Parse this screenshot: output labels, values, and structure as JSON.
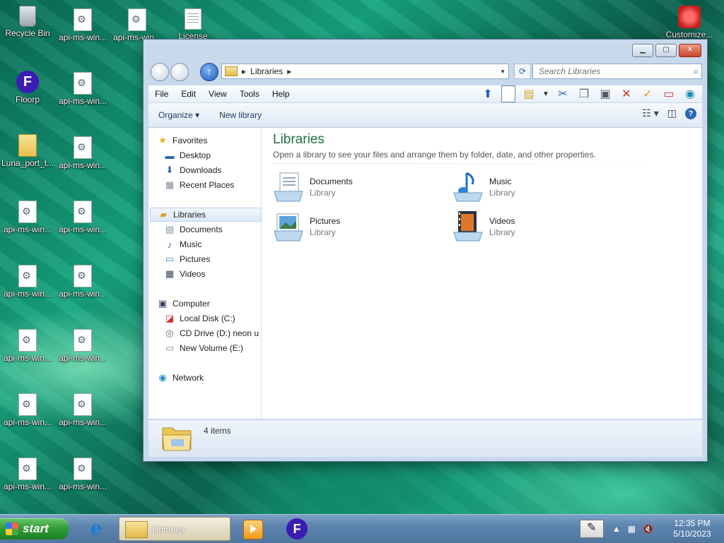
{
  "desktop": {
    "icons": [
      {
        "label": "Recycle Bin"
      },
      {
        "label": "api-ms-win..."
      },
      {
        "label": "api-ms-win..."
      },
      {
        "label": "License"
      },
      {
        "label": "Customize..."
      },
      {
        "label": "Floorp"
      },
      {
        "label": "api-ms-win..."
      },
      {
        "label": "Luna_port_t..."
      },
      {
        "label": "api-ms-win..."
      },
      {
        "label": "api-ms-win..."
      },
      {
        "label": "api-ms-win..."
      },
      {
        "label": "api-ms-win..."
      },
      {
        "label": "api-ms-win..."
      },
      {
        "label": "api-ms-win..."
      },
      {
        "label": "api-ms-win..."
      },
      {
        "label": "api-ms-win..."
      },
      {
        "label": "api-ms-win..."
      },
      {
        "label": "api-ms-win..."
      },
      {
        "label": "api-ms-win..."
      }
    ]
  },
  "window": {
    "address": {
      "crumb": "Libraries"
    },
    "search": {
      "placeholder": "Search Libraries"
    },
    "menu": [
      "File",
      "Edit",
      "View",
      "Tools",
      "Help"
    ],
    "commands": {
      "organize": "Organize ▾",
      "new_library": "New library"
    },
    "nav": {
      "favorites": "Favorites",
      "desktop": "Desktop",
      "downloads": "Downloads",
      "recent": "Recent Places",
      "libraries": "Libraries",
      "documents": "Documents",
      "music": "Music",
      "pictures": "Pictures",
      "videos": "Videos",
      "computer": "Computer",
      "local_disk": "Local Disk (C:)",
      "cd_drive": "CD Drive (D:) neon u",
      "new_volume": "New Volume (E:)",
      "network": "Network"
    },
    "content": {
      "title": "Libraries",
      "subtitle": "Open a library to see your files and arrange them by folder, date, and other properties.",
      "libraries": [
        {
          "name": "Documents",
          "type": "Library"
        },
        {
          "name": "Music",
          "type": "Library"
        },
        {
          "name": "Pictures",
          "type": "Library"
        },
        {
          "name": "Videos",
          "type": "Library"
        }
      ]
    },
    "status": {
      "items": "4 items"
    }
  },
  "taskbar": {
    "start": "start",
    "active_window": "Libraries",
    "clock": {
      "time": "12:35 PM",
      "date": "5/10/2023"
    }
  }
}
